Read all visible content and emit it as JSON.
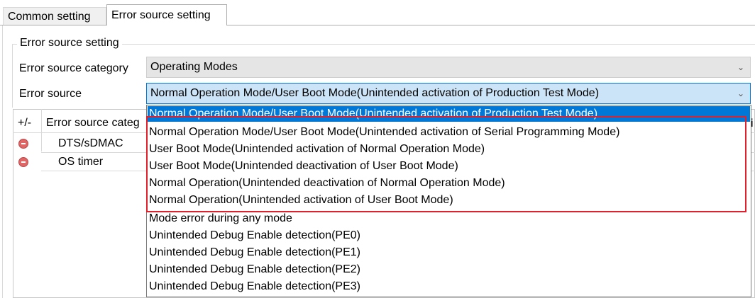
{
  "tabs": [
    {
      "label": "Common setting",
      "active": false
    },
    {
      "label": "Error source setting",
      "active": true
    }
  ],
  "group": {
    "title": "Error source setting"
  },
  "category": {
    "label": "Error source category",
    "value": "Operating Modes"
  },
  "source": {
    "label": "Error source",
    "value": "Normal Operation Mode/User Boot Mode(Unintended activation of Production Test Mode)"
  },
  "table": {
    "headers": {
      "plus_minus": "+/-",
      "category": "Error source categ",
      "trailing": "i"
    },
    "rows": [
      {
        "category": "DTS/sDMAC"
      },
      {
        "category": "OS timer"
      }
    ]
  },
  "dropdown": {
    "options": [
      "Normal Operation Mode/User Boot Mode(Unintended activation of Production Test Mode)",
      "Normal Operation Mode/User Boot Mode(Unintended activation of Serial Programming Mode)",
      "User Boot Mode(Unintended activation of Normal Operation Mode)",
      "User Boot Mode(Unintended deactivation of User Boot Mode)",
      "Normal Operation(Unintended deactivation of Normal Operation Mode)",
      "Normal Operation(Unintended activation of User Boot Mode)",
      "Mode error during any mode",
      "Unintended Debug Enable detection(PE0)",
      "Unintended Debug Enable detection(PE1)",
      "Unintended Debug Enable detection(PE2)",
      "Unintended Debug Enable detection(PE3)"
    ],
    "selected_index": 0
  },
  "icons": {
    "remove": "minus-circle-icon",
    "dropdown": "chevron-down-icon"
  },
  "colors": {
    "selection": "#0078d7",
    "highlight_box": "#e0202a",
    "remove_icon": "#e06666"
  }
}
